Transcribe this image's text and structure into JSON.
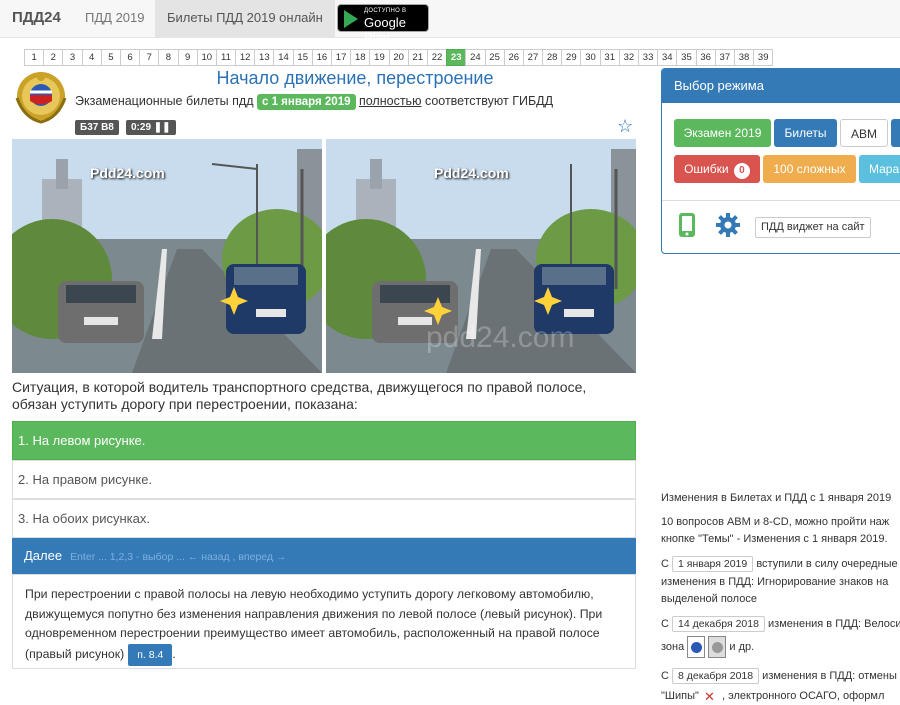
{
  "nav": {
    "brand": "ПДД24",
    "links": [
      "ПДД 2019",
      "Билеты ПДД 2019 онлайн"
    ],
    "gplay_small": "ДОСТУПНО В",
    "gplay_big": "Google Play"
  },
  "tickets": [
    "1",
    "2",
    "3",
    "4",
    "5",
    "6",
    "7",
    "8",
    "9",
    "10",
    "11",
    "12",
    "13",
    "14",
    "15",
    "16",
    "17",
    "18",
    "19",
    "20",
    "21",
    "22",
    "23",
    "24",
    "25",
    "26",
    "27",
    "28",
    "29",
    "30",
    "31",
    "32",
    "33",
    "34",
    "35",
    "36",
    "37",
    "38",
    "39"
  ],
  "active_ticket": "23",
  "question_header": {
    "title": "Начало движение, перестроение",
    "sub_prefix": "Экзаменационные билеты пдд",
    "date_badge": "с 1 января 2019",
    "sub_link": "полностью",
    "sub_suffix": "соответствуют ГИБДД",
    "ticket_code": "Б37 В8",
    "timer": "0:29"
  },
  "images": {
    "watermark": "Pdd24.com",
    "faded_watermark": "pdd24.com"
  },
  "question": "Ситуация, в которой водитель транспортного средства, движущегося по правой полосе, обязан уступить дорогу при перестроении, показана:",
  "answers": [
    {
      "text": "1. На левом рисунке.",
      "correct": true
    },
    {
      "text": "2. На правом рисунке.",
      "correct": false
    },
    {
      "text": "3. На обоих рисунках.",
      "correct": false
    }
  ],
  "next_bar": {
    "label": "Далее",
    "hint": "Enter ... 1,2,3 - выбор ... ← назад , вперед →"
  },
  "explanation": {
    "text": "При перестроении с правой полосы на левую необходимо уступить дорогу легковому автомобилю, движущемуся попутно без изменения направления движения по левой полосе (левый рисунок). При одновременном перестроении преимущество имеет автомобиль, расположенный на правой полосе (правый рисунок)",
    "rule_badge": "п. 8.4"
  },
  "mode_panel": {
    "title": "Выбор режима",
    "row1": [
      "Экзамен 2019",
      "Билеты",
      "ABM",
      "С"
    ],
    "row2_errors": "Ошибки",
    "row2_errors_count": "0",
    "row2": [
      "100 сложных",
      "Мара"
    ],
    "widget_label": "ПДД виджет на сайт"
  },
  "news": {
    "headline": "Изменения в Билетах и ПДД с 1 января 2019",
    "line1": "10 вопросов ABM и 8-CD, можно пройти наж",
    "line2": "кнопке \"Темы\" - Изменения с 1 января 2019.",
    "item1_prefix": "С",
    "item1_date": "1 января 2019",
    "item1_text": "вступили в силу очередные",
    "item1_line2": "изменения в ПДД: Игнорирование знаков на",
    "item1_line3": "выделеной полосе",
    "item2_prefix": "С",
    "item2_date": "14 декабря 2018",
    "item2_text": "изменения в ПДД: Велоси",
    "item2_line2_prefix": "зона",
    "item2_line2_suffix": "и др.",
    "item3_prefix": "С",
    "item3_date": "8 декабря 2018",
    "item3_text": "изменения в ПДД: отмены",
    "item3_line2_prefix": "\"Шипы\"",
    "item3_line2_suffix": ", электронного ОСАГО, оформл"
  },
  "colors": {
    "primary": "#337ab7",
    "success": "#5cb85c",
    "danger": "#d9534f",
    "warning": "#f0ad4e",
    "info": "#5bc0de"
  }
}
